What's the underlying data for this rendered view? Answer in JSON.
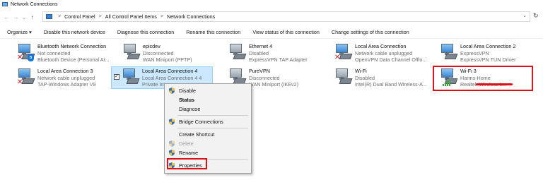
{
  "window": {
    "title": "Network Connections"
  },
  "address": {
    "crumbs": [
      "Control Panel",
      "All Control Panel Items",
      "Network Connections"
    ],
    "separator": ">",
    "back_glyph": "←",
    "forward_glyph": "→",
    "recent_glyph": "⌄",
    "up_glyph": "↑",
    "dropdown_glyph": "⌄",
    "refresh_glyph": "↻",
    "icon": "control-panel-icon"
  },
  "commands": [
    "Organize ▾",
    "Disable this network device",
    "Diagnose this connection",
    "Rename this connection",
    "View status of this connection",
    "Change settings of this connection"
  ],
  "connections": [
    {
      "name": "Bluetooth Network Connection",
      "status": "Not connected",
      "device": "Bluetooth Device (Personal Ar...",
      "icon": "bluetooth-adapter-icon",
      "badge": "✕",
      "badge_bt": "ʙ"
    },
    {
      "name": "epicdev",
      "status": "Disconnected",
      "device": "WAN Miniport (PPTP)",
      "icon": "vpn-connection-icon"
    },
    {
      "name": "Ethernet 4",
      "status": "Disabled",
      "device": "ExpressVPN TAP Adapter",
      "icon": "ethernet-adapter-icon"
    },
    {
      "name": "Local Area Connection",
      "status": "Network cable unplugged",
      "device": "OpenVPN Data Channel Offlo...",
      "icon": "ethernet-adapter-icon",
      "badge": "✕"
    },
    {
      "name": "Local Area Connection 2",
      "status": "ExpressVPN",
      "device": "ExpressVPN TUN Driver",
      "icon": "ethernet-adapter-icon"
    },
    {
      "name": "Local Area Connection 3",
      "status": "Network cable unplugged",
      "device": "TAP-Windows Adapter V9",
      "icon": "ethernet-adapter-icon",
      "badge": "✕"
    },
    {
      "name": "Local Area Connection 4",
      "status": "Local Area Connection 4 4",
      "device": "Private Int...",
      "icon": "ethernet-adapter-icon",
      "checkbox": "✓"
    },
    {
      "name": "PureVPN",
      "status": "Disconnected",
      "device": "WAN Miniport (IKEv2)",
      "icon": "vpn-connection-icon"
    },
    {
      "name": "Wi-Fi",
      "status": "Disabled",
      "device": "Intel(R) Dual Band Wireless-A...",
      "icon": "wifi-adapter-icon"
    },
    {
      "name": "Wi-Fi 3",
      "status": "Harms-Home",
      "device": "Realtek                    Wireless L...",
      "icon": "wifi-adapter-icon"
    }
  ],
  "context_menu": {
    "items": [
      {
        "label": "Disable",
        "shield": true
      },
      {
        "label": "Status",
        "bold": true
      },
      {
        "label": "Diagnose"
      },
      {
        "label": "Bridge Connections",
        "shield": true
      },
      {
        "label": "Create Shortcut"
      },
      {
        "label": "Delete",
        "shield": true,
        "disabled": true
      },
      {
        "label": "Rename",
        "shield": true
      },
      {
        "label": "Properties",
        "shield": true
      }
    ]
  },
  "colors": {
    "selection": "#cce8ff",
    "annotation_red": "#e0101a",
    "wifi_green": "#3da83d"
  }
}
